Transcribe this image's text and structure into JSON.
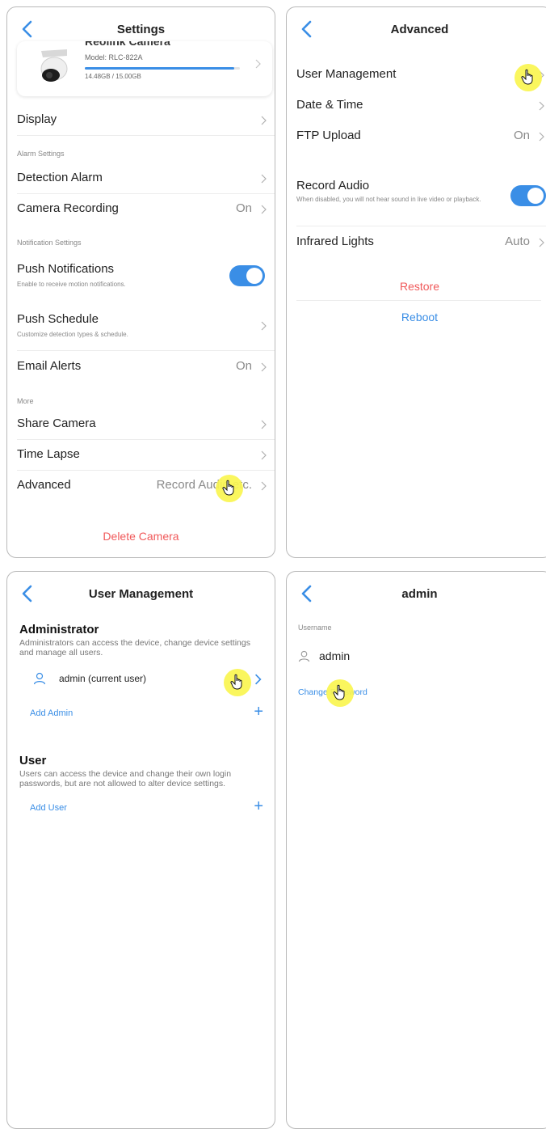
{
  "settings": {
    "title": "Settings",
    "device": {
      "name": "Reolink Camera",
      "model": "Model: RLC-822A",
      "storage": "14.48GB / 15.00GB",
      "storage_fraction": 0.965
    },
    "display": "Display",
    "alarm_section": "Alarm Settings",
    "detection_alarm": "Detection Alarm",
    "camera_recording": {
      "label": "Camera Recording",
      "value": "On"
    },
    "notification_section": "Notification Settings",
    "push_notifications": {
      "label": "Push Notifications",
      "sub": "Enable to receive motion notifications.",
      "on": true
    },
    "push_schedule": {
      "label": "Push Schedule",
      "sub": "Customize detection types & schedule."
    },
    "email_alerts": {
      "label": "Email Alerts",
      "value": "On"
    },
    "more_section": "More",
    "share_camera": "Share Camera",
    "time_lapse": "Time Lapse",
    "advanced": {
      "label": "Advanced",
      "value": "Record Audio etc."
    },
    "delete": "Delete Camera"
  },
  "advanced": {
    "title": "Advanced",
    "user_management": "User Management",
    "date_time": "Date & Time",
    "ftp_upload": {
      "label": "FTP Upload",
      "value": "On"
    },
    "record_audio": {
      "label": "Record Audio",
      "sub": "When disabled, you will not hear sound in live video or playback.",
      "on": true
    },
    "infrared": {
      "label": "Infrared Lights",
      "value": "Auto"
    },
    "restore": "Restore",
    "reboot": "Reboot"
  },
  "user_mgmt": {
    "title": "User Management",
    "admin_heading": "Administrator",
    "admin_desc": "Administrators can access the device, change device settings and manage all users.",
    "admin_user": "admin (current user)",
    "add_admin": "Add Admin",
    "user_heading": "User",
    "user_desc": "Users can access the device and change their own login passwords, but are not allowed to alter device settings.",
    "add_user": "Add User"
  },
  "admin_detail": {
    "title": "admin",
    "username_label": "Username",
    "username": "admin",
    "change_password": "Change Password"
  },
  "colors": {
    "accent": "#3a8ee6",
    "danger": "#f0595a",
    "cursor_highlight": "#faf550"
  },
  "icons": [
    "back-chevron-icon",
    "chevron-right-icon",
    "user-icon",
    "plus-icon",
    "hand-pointer-icon"
  ]
}
